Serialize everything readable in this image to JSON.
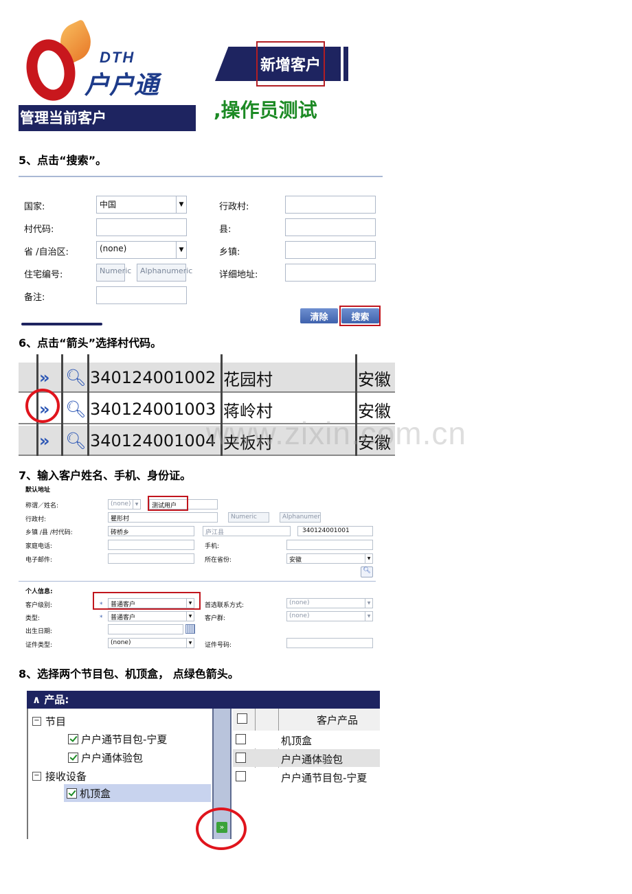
{
  "header": {
    "logo_brand": "DTH",
    "logo_name": "户户通",
    "tab_title": "新增客户",
    "manage_label": "管理当前客户",
    "operator_text": ",操作员测试"
  },
  "steps": {
    "s5": "5、点击“搜索”。",
    "s6": "6、点击“箭头”选择村代码。",
    "s7": "7、输入客户姓名、手机、身份证。",
    "s8": "8、选择两个节目包、机顶盒， 点绿色箭头。"
  },
  "search_form": {
    "country_label": "国家:",
    "country_value": "中国",
    "village_code_label": "村代码:",
    "province_label": "省 /自治区:",
    "province_value": "(none)",
    "house_no_label": "住宅编号:",
    "numeric_ph": "Numeric",
    "alnum_ph": "Alphanumeric",
    "remark_label": "备注:",
    "admin_village_label": "行政村:",
    "county_label": "县:",
    "town_label": "乡镇:",
    "detail_addr_label": "详细地址:",
    "clear_btn": "清除",
    "search_btn": "搜索"
  },
  "village_rows": [
    {
      "code": "340124001002",
      "name": "花园村",
      "prov": "安徽"
    },
    {
      "code": "340124001003",
      "name": "蒋岭村",
      "prov": "安徽"
    },
    {
      "code": "340124001004",
      "name": "夹板村",
      "prov": "安徽"
    }
  ],
  "customer_form": {
    "section_addr": "默认地址",
    "title_name_label": "称谓／姓名:",
    "title_value": "(none)",
    "name_value": "测试用户",
    "admin_village_label": "行政村:",
    "admin_village_value": "瞿形村",
    "numeric_ph": "Numeric",
    "alnum_ph": "Alphanumeric",
    "town_county_code_label": "乡镇 /县 /村代码:",
    "town_value": "砖桥乡",
    "county_value": "庐江县",
    "code_value": "340124001001",
    "home_phone_label": "家庭电话:",
    "mobile_label": "手机:",
    "email_label": "电子邮件:",
    "province_label": "所在省份:",
    "province_value": "安徽",
    "section_personal": "个人信息:",
    "level_label": "客户级别:",
    "level_value": "普通客户",
    "contact_label": "首选联系方式:",
    "contact_value": "(none)",
    "type_label": "类型:",
    "type_value": "普通客户",
    "group_label": "客户群:",
    "group_value": "(none)",
    "birth_label": "出生日期:",
    "id_type_label": "证件类型:",
    "id_type_value": "(none)",
    "id_no_label": "证件号码:"
  },
  "product_panel": {
    "title": "产品:",
    "group_program": "节目",
    "item_pkg_ningxia": "户户通节目包-宁夏",
    "item_pkg_trial": "户户通体验包",
    "group_device": "接收设备",
    "item_stb": "机顶盒",
    "col_customer_product": "客户产品",
    "right_rows": [
      "机顶盒",
      "户户通体验包",
      "户户通节目包-宁夏"
    ]
  },
  "watermark": "www.zixin.com.cn"
}
